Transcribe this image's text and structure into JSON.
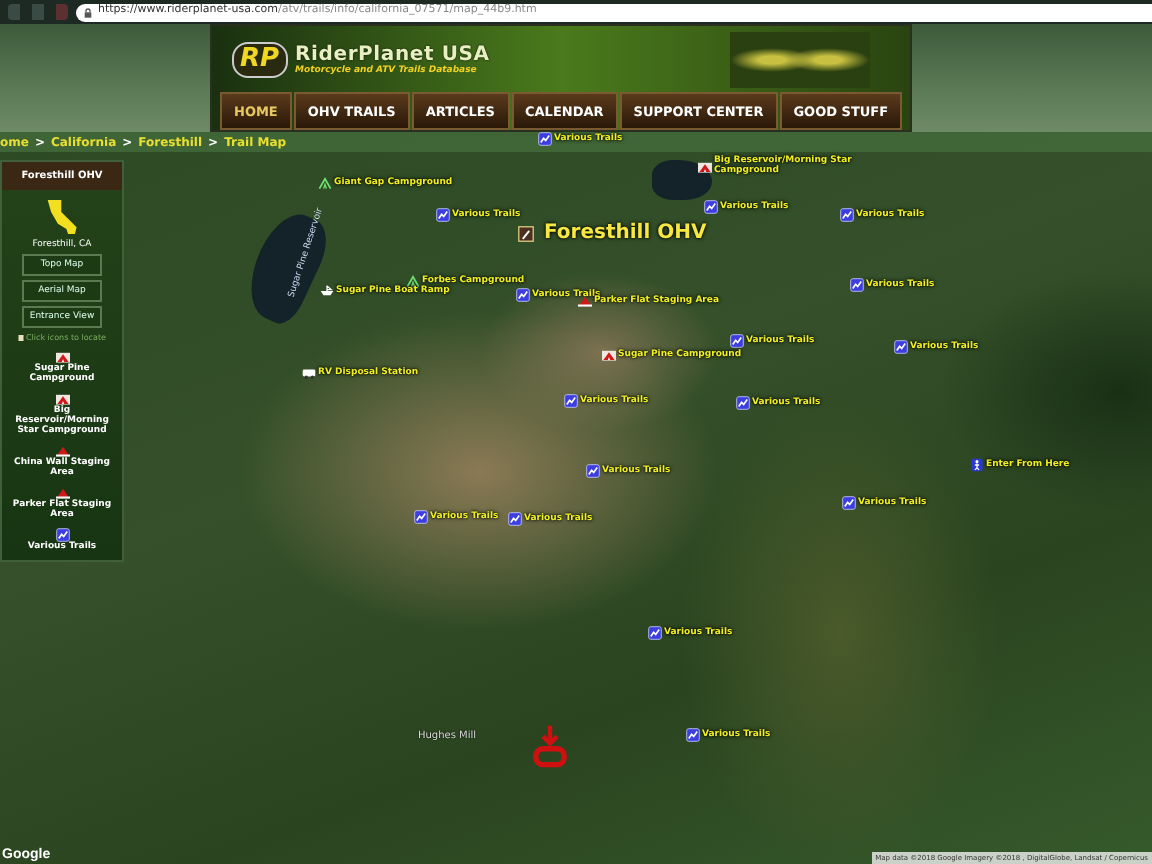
{
  "browser": {
    "url_host": "https://www.riderplanet-usa.com",
    "url_path": "/atv/trails/info/california_07571/map_44b9.htm"
  },
  "site": {
    "logo_mark": "RP",
    "name": "RiderPlanet USA",
    "tagline": "Motorcycle and ATV Trails Database"
  },
  "nav": [
    {
      "label": "HOME",
      "selected": true
    },
    {
      "label": "OHV TRAILS",
      "selected": false
    },
    {
      "label": "ARTICLES",
      "selected": false
    },
    {
      "label": "CALENDAR",
      "selected": false
    },
    {
      "label": "SUPPORT CENTER",
      "selected": false
    },
    {
      "label": "GOOD STUFF",
      "selected": false
    }
  ],
  "breadcrumb": {
    "separator": ">",
    "items": [
      "ome",
      "California",
      "Foresthill",
      "Trail Map"
    ]
  },
  "sidebar": {
    "title": "Foresthill OHV",
    "location": "Foresthill, CA",
    "buttons": [
      "Topo Map",
      "Aerial Map",
      "Entrance View"
    ],
    "hint": "Click icons to locate",
    "legend": [
      {
        "kind": "campground",
        "label": "Sugar Pine Campground"
      },
      {
        "kind": "campground",
        "label": "Big Reservoir/Morning Star Campground"
      },
      {
        "kind": "staging",
        "label": "China Wall Staging Area"
      },
      {
        "kind": "staging",
        "label": "Parker Flat Staging Area"
      },
      {
        "kind": "trail",
        "label": "Various Trails"
      }
    ]
  },
  "map": {
    "markers": [
      {
        "kind": "trail",
        "label": "Various Trails"
      },
      {
        "kind": "tent",
        "label": "Giant Gap Campground"
      },
      {
        "kind": "campground",
        "label": "Big Reservoir/Morning Star Campground"
      },
      {
        "kind": "trail",
        "label": "Various Trails"
      },
      {
        "kind": "trail",
        "label": "Various Trails"
      },
      {
        "kind": "trail",
        "label": "Various Trails"
      },
      {
        "kind": "area",
        "label": "Foresthill OHV"
      },
      {
        "kind": "tent",
        "label": "Forbes Campground"
      },
      {
        "kind": "trail",
        "label": "Various Trails"
      },
      {
        "kind": "ramp",
        "label": "Sugar Pine Boat Ramp"
      },
      {
        "kind": "trail",
        "label": "Various Trails"
      },
      {
        "kind": "staging",
        "label": "Parker Flat Staging Area"
      },
      {
        "kind": "trail",
        "label": "Various Trails"
      },
      {
        "kind": "trail",
        "label": "Various Trails"
      },
      {
        "kind": "campground",
        "label": "Sugar Pine Campground"
      },
      {
        "kind": "rv",
        "label": "RV Disposal Station"
      },
      {
        "kind": "trail",
        "label": "Various Trails"
      },
      {
        "kind": "trail",
        "label": "Various Trails"
      },
      {
        "kind": "entrance",
        "label": "Enter From Here"
      },
      {
        "kind": "trail",
        "label": "Various Trails"
      },
      {
        "kind": "trail",
        "label": "Various Trails"
      },
      {
        "kind": "trail",
        "label": "Various Trails"
      },
      {
        "kind": "trail",
        "label": "Various Trails"
      },
      {
        "kind": "trail",
        "label": "Various Trails"
      },
      {
        "kind": "trail",
        "label": "Various Trails"
      }
    ],
    "lake_label": "Sugar Pine Reservoir",
    "place_label": "Hughes Mill",
    "logo": "Google",
    "attribution": "Map data ©2018 Google Imagery ©2018 , DigitalGlobe, Landsat / Copernicus"
  }
}
